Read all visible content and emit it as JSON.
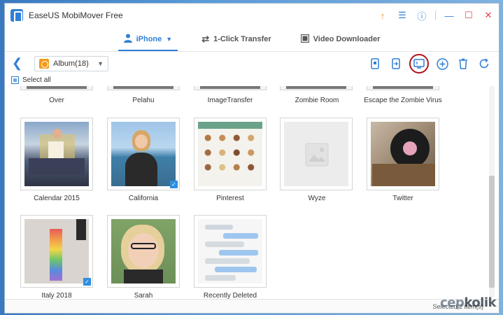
{
  "window": {
    "title": "EaseUS MobiMover Free"
  },
  "nav": {
    "tabs": [
      {
        "label": "iPhone",
        "icon": "person-icon",
        "active": true
      },
      {
        "label": "1-Click Transfer",
        "icon": "transfer-arrows-icon",
        "active": false
      },
      {
        "label": "Video Downloader",
        "icon": "video-icon",
        "active": false
      }
    ]
  },
  "toolbar": {
    "album_select_value": "Album(18)",
    "actions": [
      "to-phone-icon",
      "to-computer-icon",
      "to-tv-icon",
      "add-icon",
      "trash-icon",
      "refresh-icon"
    ]
  },
  "select_all_label": "Select all",
  "albums_top_row": [
    "Over",
    "Pelahu",
    "ImageTransfer",
    "Zombie Room",
    "Escape the Zombie Virus"
  ],
  "albums": [
    {
      "label": "Calendar 2015",
      "checked": false
    },
    {
      "label": "California",
      "checked": true
    },
    {
      "label": "Pinterest",
      "checked": false
    },
    {
      "label": "Wyze",
      "checked": false
    },
    {
      "label": "Twitter",
      "checked": false
    },
    {
      "label": "Italy 2018",
      "checked": true
    },
    {
      "label": "Sarah",
      "checked": false
    },
    {
      "label": "Recently Deleted",
      "checked": false
    }
  ],
  "status": {
    "text": "Selected 2 item(s)"
  },
  "watermark": {
    "part1": "cep",
    "part2": "kolik"
  },
  "colors": {
    "accent": "#2f7fd8",
    "highlight_ring": "#b0141e",
    "check": "#2f8fe0"
  }
}
